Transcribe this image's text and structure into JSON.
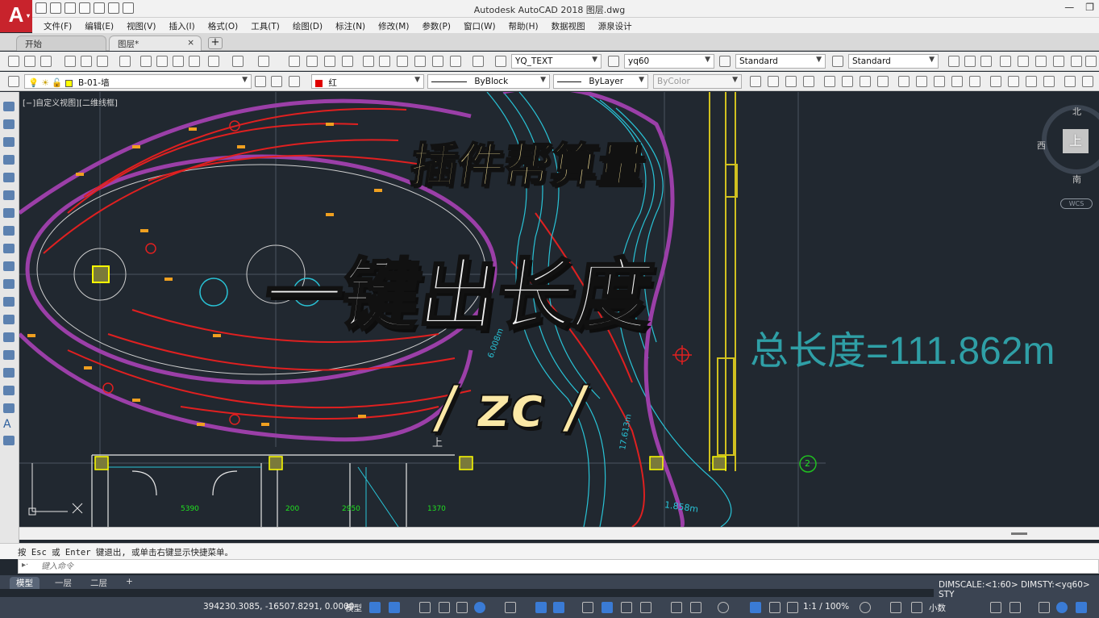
{
  "app": {
    "title": "Autodesk AutoCAD 2018    图层.dwg",
    "logo_letter": "A"
  },
  "menu": [
    "文件(F)",
    "编辑(E)",
    "视图(V)",
    "插入(I)",
    "格式(O)",
    "工具(T)",
    "绘图(D)",
    "标注(N)",
    "修改(M)",
    "参数(P)",
    "窗口(W)",
    "帮助(H)",
    "数据视图",
    "源泉设计"
  ],
  "tabs": {
    "start": "开始",
    "doc": "图层*",
    "close": "×",
    "add": "+"
  },
  "toolbar1": {
    "text_style": "YQ_TEXT",
    "dim_style": "yq60",
    "table_style": "Standard",
    "mleader_style": "Standard"
  },
  "toolbar2": {
    "layer": "B-01-墙",
    "color": "红",
    "linetype": "ByBlock",
    "lineweight": "ByLayer",
    "plotstyle": "ByColor"
  },
  "viewport": {
    "label": "[−]自定义视图][二维线框]"
  },
  "viewcube": {
    "north": "北",
    "south": "南",
    "west": "西",
    "face": "上",
    "wcs": "WCS"
  },
  "overlay": {
    "subtitle": "插件帮算量",
    "title": "一键出长度",
    "command": "/ zc /",
    "total_length": "总长度=111.862m"
  },
  "drawing_texts": {
    "dim1": "5390",
    "dim2": "200",
    "dim3": "2950",
    "dim4": "1370",
    "circle_tag": "2",
    "stair_label": "上",
    "len1": "1.858m",
    "len2": "6.008m",
    "len3": "17.613m"
  },
  "command": {
    "history": "按 Esc 或 Enter 键退出, 或单击右键显示快捷菜单。",
    "placeholder": "键入命令",
    "close": "×"
  },
  "layout_tabs": [
    "模型",
    "一层",
    "二层"
  ],
  "status": {
    "dimscale": "DIMSCALE:<1:60> DIMSTY:<yq60> STY",
    "coords": "394230.3085, -16507.8291, 0.0000",
    "model": "模型",
    "scale": "1:1 / 100%",
    "units": "小数"
  },
  "colors": {
    "canvas": "#212830",
    "overlay_yellow": "#f7e39a",
    "total_teal": "#2f9fa6",
    "red": "#e02020",
    "magenta": "#9b3fa8",
    "cyan": "#29c3d6"
  }
}
